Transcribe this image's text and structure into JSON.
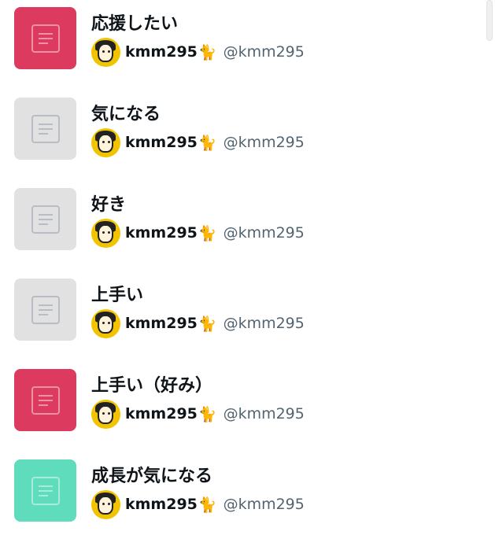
{
  "colors": {
    "pink": "#dc3a5f",
    "gray": "#e1e1e1",
    "teal": "#5fdcbb"
  },
  "items": [
    {
      "title": "応援したい",
      "thumb_color": "pink",
      "icon": "document-icon",
      "user": {
        "name": "kmm295",
        "emoji": "🐈",
        "handle": "@kmm295"
      }
    },
    {
      "title": "気になる",
      "thumb_color": "gray",
      "icon": "document-icon",
      "user": {
        "name": "kmm295",
        "emoji": "🐈",
        "handle": "@kmm295"
      }
    },
    {
      "title": "好き",
      "thumb_color": "gray",
      "icon": "document-icon",
      "user": {
        "name": "kmm295",
        "emoji": "🐈",
        "handle": "@kmm295"
      }
    },
    {
      "title": "上手い",
      "thumb_color": "gray",
      "icon": "document-icon",
      "user": {
        "name": "kmm295",
        "emoji": "🐈",
        "handle": "@kmm295"
      }
    },
    {
      "title": "上手い（好み）",
      "thumb_color": "pink",
      "icon": "document-icon",
      "user": {
        "name": "kmm295",
        "emoji": "🐈",
        "handle": "@kmm295"
      }
    },
    {
      "title": "成長が気になる",
      "thumb_color": "teal",
      "icon": "document-icon",
      "user": {
        "name": "kmm295",
        "emoji": "🐈",
        "handle": "@kmm295"
      }
    }
  ]
}
